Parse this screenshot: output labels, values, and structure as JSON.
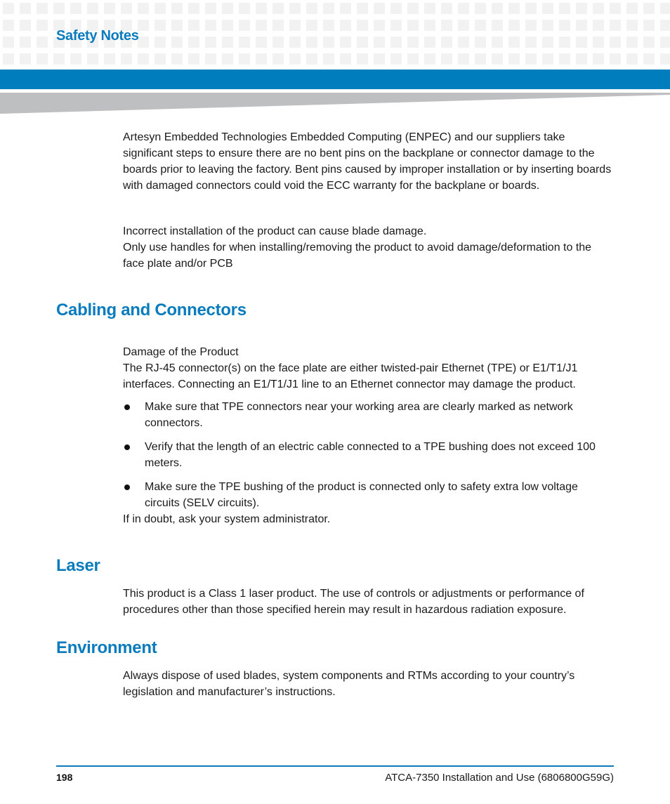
{
  "header": {
    "section_label": "Safety Notes",
    "brand_color": "#007dbd",
    "accent_gray": "#bebfc1"
  },
  "intro": {
    "paragraph1": "Artesyn Embedded Technologies Embedded Computing (ENPEC) and our suppliers take significant steps to ensure there are no bent pins on the backplane or connector damage to the boards prior to leaving the factory. Bent pins caused by improper installation or by inserting boards with damaged connectors could void the ECC warranty for the backplane or boards.",
    "paragraph2_line1": "Incorrect installation of the product can cause blade damage.",
    "paragraph2_line2": "Only use handles for when installing/removing the product to avoid damage/deformation to the face plate and/or PCB"
  },
  "sections": [
    {
      "title": "Cabling and Connectors",
      "lead": "Damage of the Product",
      "text": "The RJ-45 connector(s) on the face plate are either twisted-pair Ethernet (TPE) or E1/T1/J1 interfaces. Connecting an E1/T1/J1 line to an Ethernet connector may damage the product.",
      "bullets": [
        "Make sure that TPE connectors near your working area are clearly marked as network connectors.",
        "Verify that the length of an electric cable connected to a TPE bushing does not exceed 100 meters.",
        "Make sure the TPE bushing of the product is connected only to safety extra low voltage circuits (SELV circuits)."
      ],
      "closing": "If in doubt, ask your system administrator."
    },
    {
      "title": "Laser",
      "text": "This product is a Class 1 laser product. The use of controls or adjustments or performance of procedures other than those specified herein may result in hazardous radiation exposure."
    },
    {
      "title": "Environment",
      "text": "Always dispose of used blades, system components and RTMs according to your country’s legislation and manufacturer’s instructions."
    }
  ],
  "footer": {
    "page_number": "198",
    "document_title": "ATCA-7350 Installation and Use (6806800G59G)"
  }
}
